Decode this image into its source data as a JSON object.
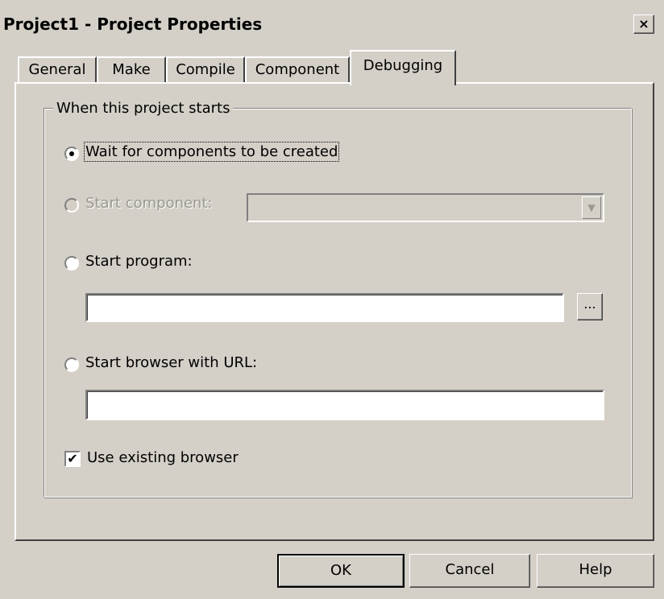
{
  "window": {
    "title": "Project1 - Project Properties",
    "close_glyph": "×"
  },
  "tabs": [
    {
      "label": "General",
      "active": false
    },
    {
      "label": "Make",
      "active": false
    },
    {
      "label": "Compile",
      "active": false
    },
    {
      "label": "Component",
      "active": false
    },
    {
      "label": "Debugging",
      "active": true
    }
  ],
  "debugging": {
    "group_label": "When this project starts",
    "options": {
      "wait": {
        "label": "Wait for components to be created",
        "selected": true,
        "enabled": true
      },
      "start_component": {
        "label": "Start component:",
        "selected": false,
        "enabled": false,
        "value": ""
      },
      "start_program": {
        "label": "Start program:",
        "selected": false,
        "enabled": true,
        "value": ""
      },
      "start_browser": {
        "label": "Start browser with URL:",
        "selected": false,
        "enabled": true,
        "value": ""
      }
    },
    "browse_button": "...",
    "use_existing_browser": {
      "label": "Use existing browser",
      "checked": true
    }
  },
  "buttons": {
    "ok": "OK",
    "cancel": "Cancel",
    "help": "Help"
  },
  "colors": {
    "face": "#d4d0c8",
    "disabled_text": "#9a988f"
  }
}
